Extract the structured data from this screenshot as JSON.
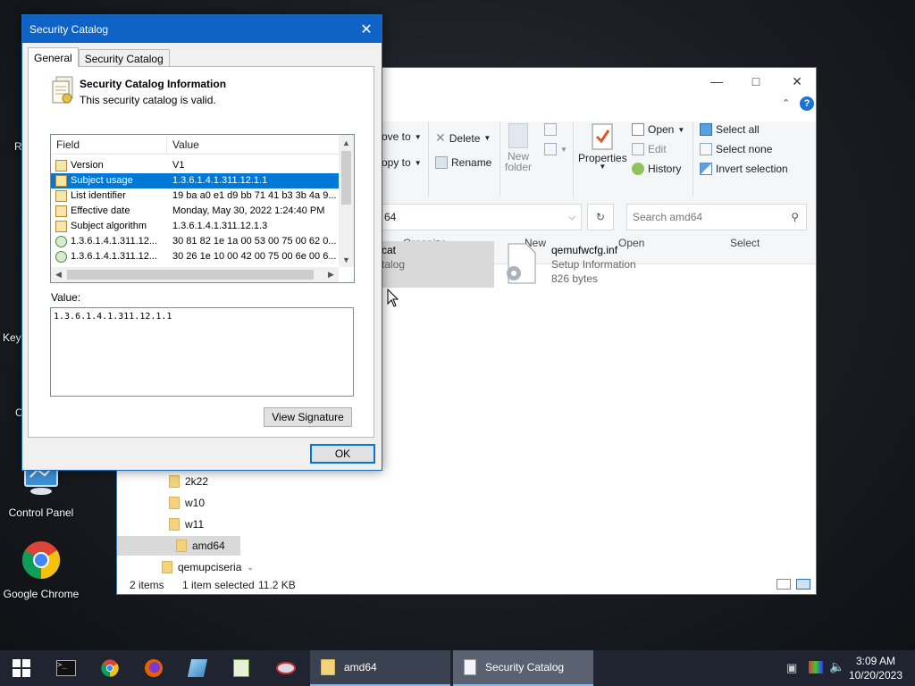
{
  "desktop": {
    "icons": [
      {
        "label": "Control Panel"
      },
      {
        "label": "Google Chrome"
      }
    ],
    "partial_labels": [
      "R",
      "Keyl",
      "C"
    ]
  },
  "explorer": {
    "ribbon": {
      "move_to": "ove to",
      "copy_to": "opy to",
      "delete": "Delete",
      "rename": "Rename",
      "organize": "Organize",
      "new_folder_line1": "New",
      "new_folder_line2": "folder",
      "new": "New",
      "properties": "Properties",
      "open": "Open",
      "edit": "Edit",
      "history": "History",
      "open_group": "Open",
      "select_all": "Select all",
      "select_none": "Select none",
      "invert_selection": "Invert selection",
      "select_group": "Select"
    },
    "address": {
      "path": "64"
    },
    "search": {
      "placeholder": "Search amd64"
    },
    "nav": [
      "2k22",
      "w10",
      "w11",
      "amd64",
      "qemupciseria"
    ],
    "files": [
      {
        "name": "cat",
        "type": "talog"
      },
      {
        "name": "qemufwcfg.inf",
        "type": "Setup Information",
        "size": "826 bytes"
      }
    ],
    "status": {
      "items": "2 items",
      "selected": "1 item selected",
      "size": "11.2 KB"
    }
  },
  "dialog": {
    "title": "Security Catalog",
    "tabs": [
      "General",
      "Security Catalog"
    ],
    "info_heading": "Security Catalog Information",
    "info_status": "This security catalog is valid.",
    "columns": {
      "field": "Field",
      "value": "Value"
    },
    "rows": [
      {
        "field": "Version",
        "value": "V1"
      },
      {
        "field": "Subject usage",
        "value": "1.3.6.1.4.1.311.12.1.1"
      },
      {
        "field": "List identifier",
        "value": "19 ba a0 e1 d9 bb 71 41 b3 3b 4a 9..."
      },
      {
        "field": "Effective date",
        "value": "Monday, May 30, 2022 1:24:40 PM"
      },
      {
        "field": "Subject algorithm",
        "value": "1.3.6.1.4.1.311.12.1.3"
      },
      {
        "field": "1.3.6.1.4.1.311.12...",
        "value": "30 81 82 1e 1a 00 53 00 75 00 62 0..."
      },
      {
        "field": "1.3.6.1.4.1.311.12...",
        "value": "30 26 1e 10 00 42 00 75 00 6e 00 6..."
      }
    ],
    "selected_row": 1,
    "value_label": "Value:",
    "value_text": "1.3.6.1.4.1.311.12.1.1",
    "view_signature": "View Signature",
    "ok": "OK"
  },
  "taskbar": {
    "tasks": [
      {
        "label": "amd64"
      },
      {
        "label": "Security Catalog"
      }
    ],
    "time": "3:09 AM",
    "date": "10/20/2023"
  }
}
